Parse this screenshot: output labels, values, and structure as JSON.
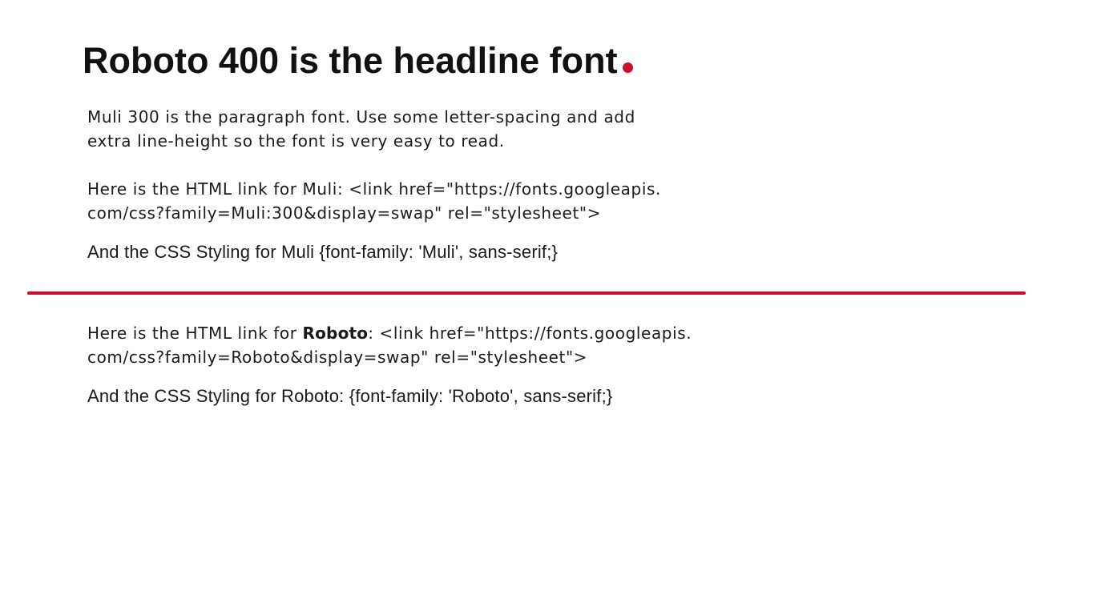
{
  "colors": {
    "accent": "#c8102e",
    "text": "#111111"
  },
  "headline": {
    "text": "Roboto 400 is the headline font"
  },
  "paragraph_font_description": {
    "line1": "Muli 300 is the paragraph font. Use some letter-spacing and add",
    "line2": "extra line-height so the font is very easy to read."
  },
  "muli_link": {
    "line1": "Here is the HTML link for Muli: <link href=\"https://fonts.googleapis.",
    "line2": "com/css?family=Muli:300&display=swap\" rel=\"stylesheet\">"
  },
  "muli_css": {
    "text": "And the CSS Styling for Muli {font-family: 'Muli', sans-serif;}"
  },
  "roboto_link": {
    "prefix": "Here is the HTML link for ",
    "font_name": "Roboto",
    "suffix": ": <link href=\"https://fonts.googleapis.",
    "line2": "com/css?family=Roboto&display=swap\" rel=\"stylesheet\">"
  },
  "roboto_css": {
    "text": "And the CSS Styling for Roboto:  {font-family: 'Roboto', sans-serif;}"
  }
}
